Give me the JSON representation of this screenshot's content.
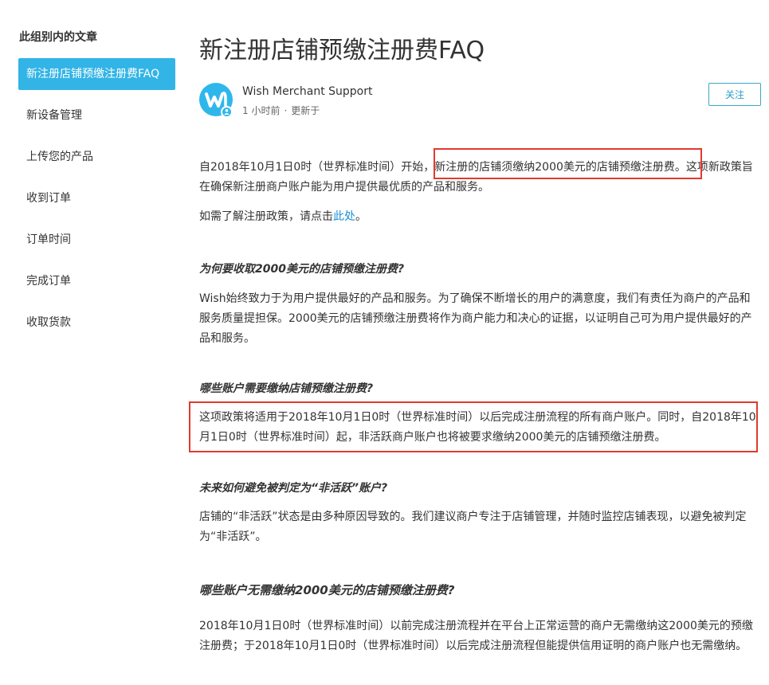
{
  "sidebar": {
    "title": "此组别内的文章",
    "items": [
      {
        "label": "新注册店铺预缴注册费FAQ",
        "active": true
      },
      {
        "label": "新设备管理"
      },
      {
        "label": "上传您的产品"
      },
      {
        "label": "收到订单"
      },
      {
        "label": "订单时间"
      },
      {
        "label": "完成订单"
      },
      {
        "label": "收取货款"
      }
    ]
  },
  "article": {
    "title": "新注册店铺预缴注册费FAQ",
    "author": {
      "name": "Wish Merchant Support",
      "time": "1 小时前",
      "separator": "·",
      "updated": "更新于"
    },
    "follow_label": "关注",
    "intro": {
      "before_highlight": "自2018年10月1日0时（世界标准时间）开始，",
      "highlight": "新注册的店铺须缴纳2000美元的店铺预缴注册费",
      "after_highlight": "。这项新政策旨在确保新注册商户账户能为用户提供最优质的产品和服务。"
    },
    "policy_line": {
      "before_link": "如需了解注册政策，请点击",
      "link": "此处",
      "after_link": "。"
    },
    "sections": [
      {
        "heading": "为何要收取2000美元的店铺预缴注册费?",
        "body": "Wish始终致力于为用户提供最好的产品和服务。为了确保不断增长的用户的满意度，我们有责任为商户的产品和服务质量提担保。2000美元的店铺预缴注册费将作为商户能力和决心的证据，以证明自己可为用户提供最好的产品和服务。"
      },
      {
        "heading": "哪些账户需要缴纳店铺预缴注册费?",
        "body": "这项政策将适用于2018年10月1日0时（世界标准时间）以后完成注册流程的所有商户账户。同时，自2018年10月1日0时（世界标准时间）起，非活跃商户账户也将被要求缴纳2000美元的店铺预缴注册费。"
      },
      {
        "heading": "未来如何避免被判定为“非活跃”账户?",
        "body": "店铺的“非活跃”状态是由多种原因导致的。我们建议商户专注于店铺管理，并随时监控店铺表现，以避免被判定为“非活跃”。"
      },
      {
        "heading": "哪些账户无需缴纳2000美元的店铺预缴注册费?",
        "body": "2018年10月1日0时（世界标准时间）以前完成注册流程并在平台上正常运营的商户无需缴纳这2000美元的预缴注册费；于2018年10月1日0时（世界标准时间）以后完成注册流程但能提供信用证明的商户账户也无需缴纳。"
      }
    ]
  },
  "colors": {
    "accent": "#32b4e6",
    "link": "#1a8fd0",
    "highlight_border": "#e03a2e"
  },
  "icons": {
    "avatar": "wish-logo-icon",
    "badge": "user-badge-icon"
  }
}
